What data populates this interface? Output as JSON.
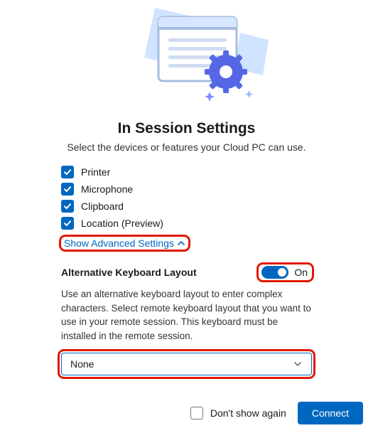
{
  "title": "In Session Settings",
  "subtitle": "Select the devices or features your Cloud PC can use.",
  "features": {
    "printer": {
      "label": "Printer",
      "checked": true
    },
    "microphone": {
      "label": "Microphone",
      "checked": true
    },
    "clipboard": {
      "label": "Clipboard",
      "checked": true
    },
    "location": {
      "label": "Location (Preview)",
      "checked": true
    }
  },
  "advanced_link": "Show Advanced Settings",
  "alt_keyboard": {
    "heading": "Alternative Keyboard Layout",
    "toggle_state": "On",
    "description": "Use an alternative keyboard layout to enter complex characters. Select remote keyboard layout that you want to use in your remote session. This keyboard must be installed in the remote session.",
    "selected": "None"
  },
  "footer": {
    "dont_show_again": "Don't show again",
    "connect": "Connect"
  },
  "colors": {
    "accent": "#0067c0",
    "highlight": "#e11900"
  }
}
